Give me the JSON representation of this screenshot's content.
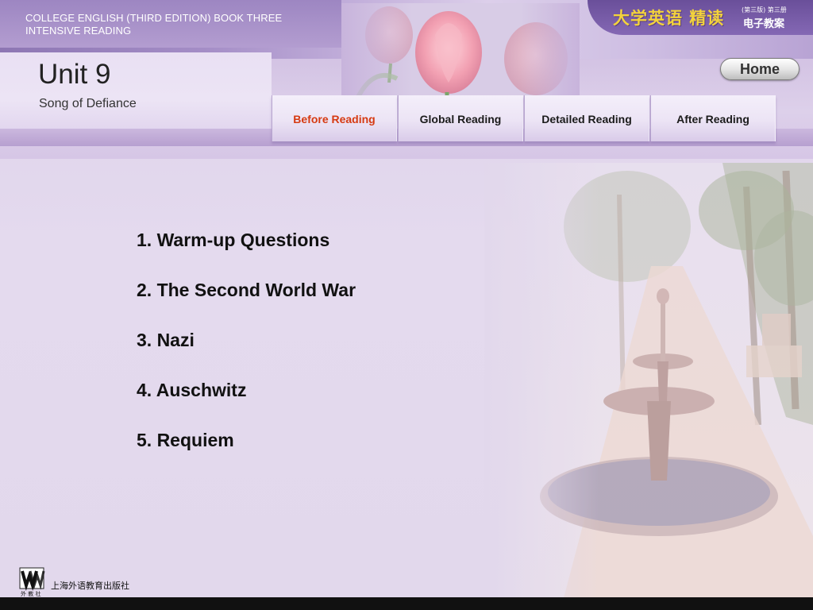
{
  "header": {
    "top_line_1": "COLLEGE ENGLISH (THIRD EDITION) BOOK THREE",
    "top_line_2": "INTENSIVE READING",
    "cn_title": "大学英语 精读",
    "cn_edition": "(第三版) 第三册",
    "cn_sub": "电子教案"
  },
  "unit": {
    "title": "Unit 9",
    "subtitle": "Song of Defiance"
  },
  "home_button": {
    "label": "Home"
  },
  "tabs": [
    {
      "label": "Before Reading",
      "active": true
    },
    {
      "label": "Global Reading",
      "active": false
    },
    {
      "label": "Detailed Reading",
      "active": false
    },
    {
      "label": "After Reading",
      "active": false
    }
  ],
  "menu_items": [
    "1. Warm-up Questions",
    "2. The Second World War",
    "3. Nazi",
    "4. Auschwitz",
    "5. Requiem"
  ],
  "footer": {
    "publisher": "上海外语教育出版社",
    "logo_mark": "W",
    "logo_caption": "外 教 社"
  },
  "colors": {
    "active_tab": "#d63a12",
    "header_purple": "#8d76b3",
    "cn_title": "#f3d33c",
    "background": "#e4daee"
  }
}
